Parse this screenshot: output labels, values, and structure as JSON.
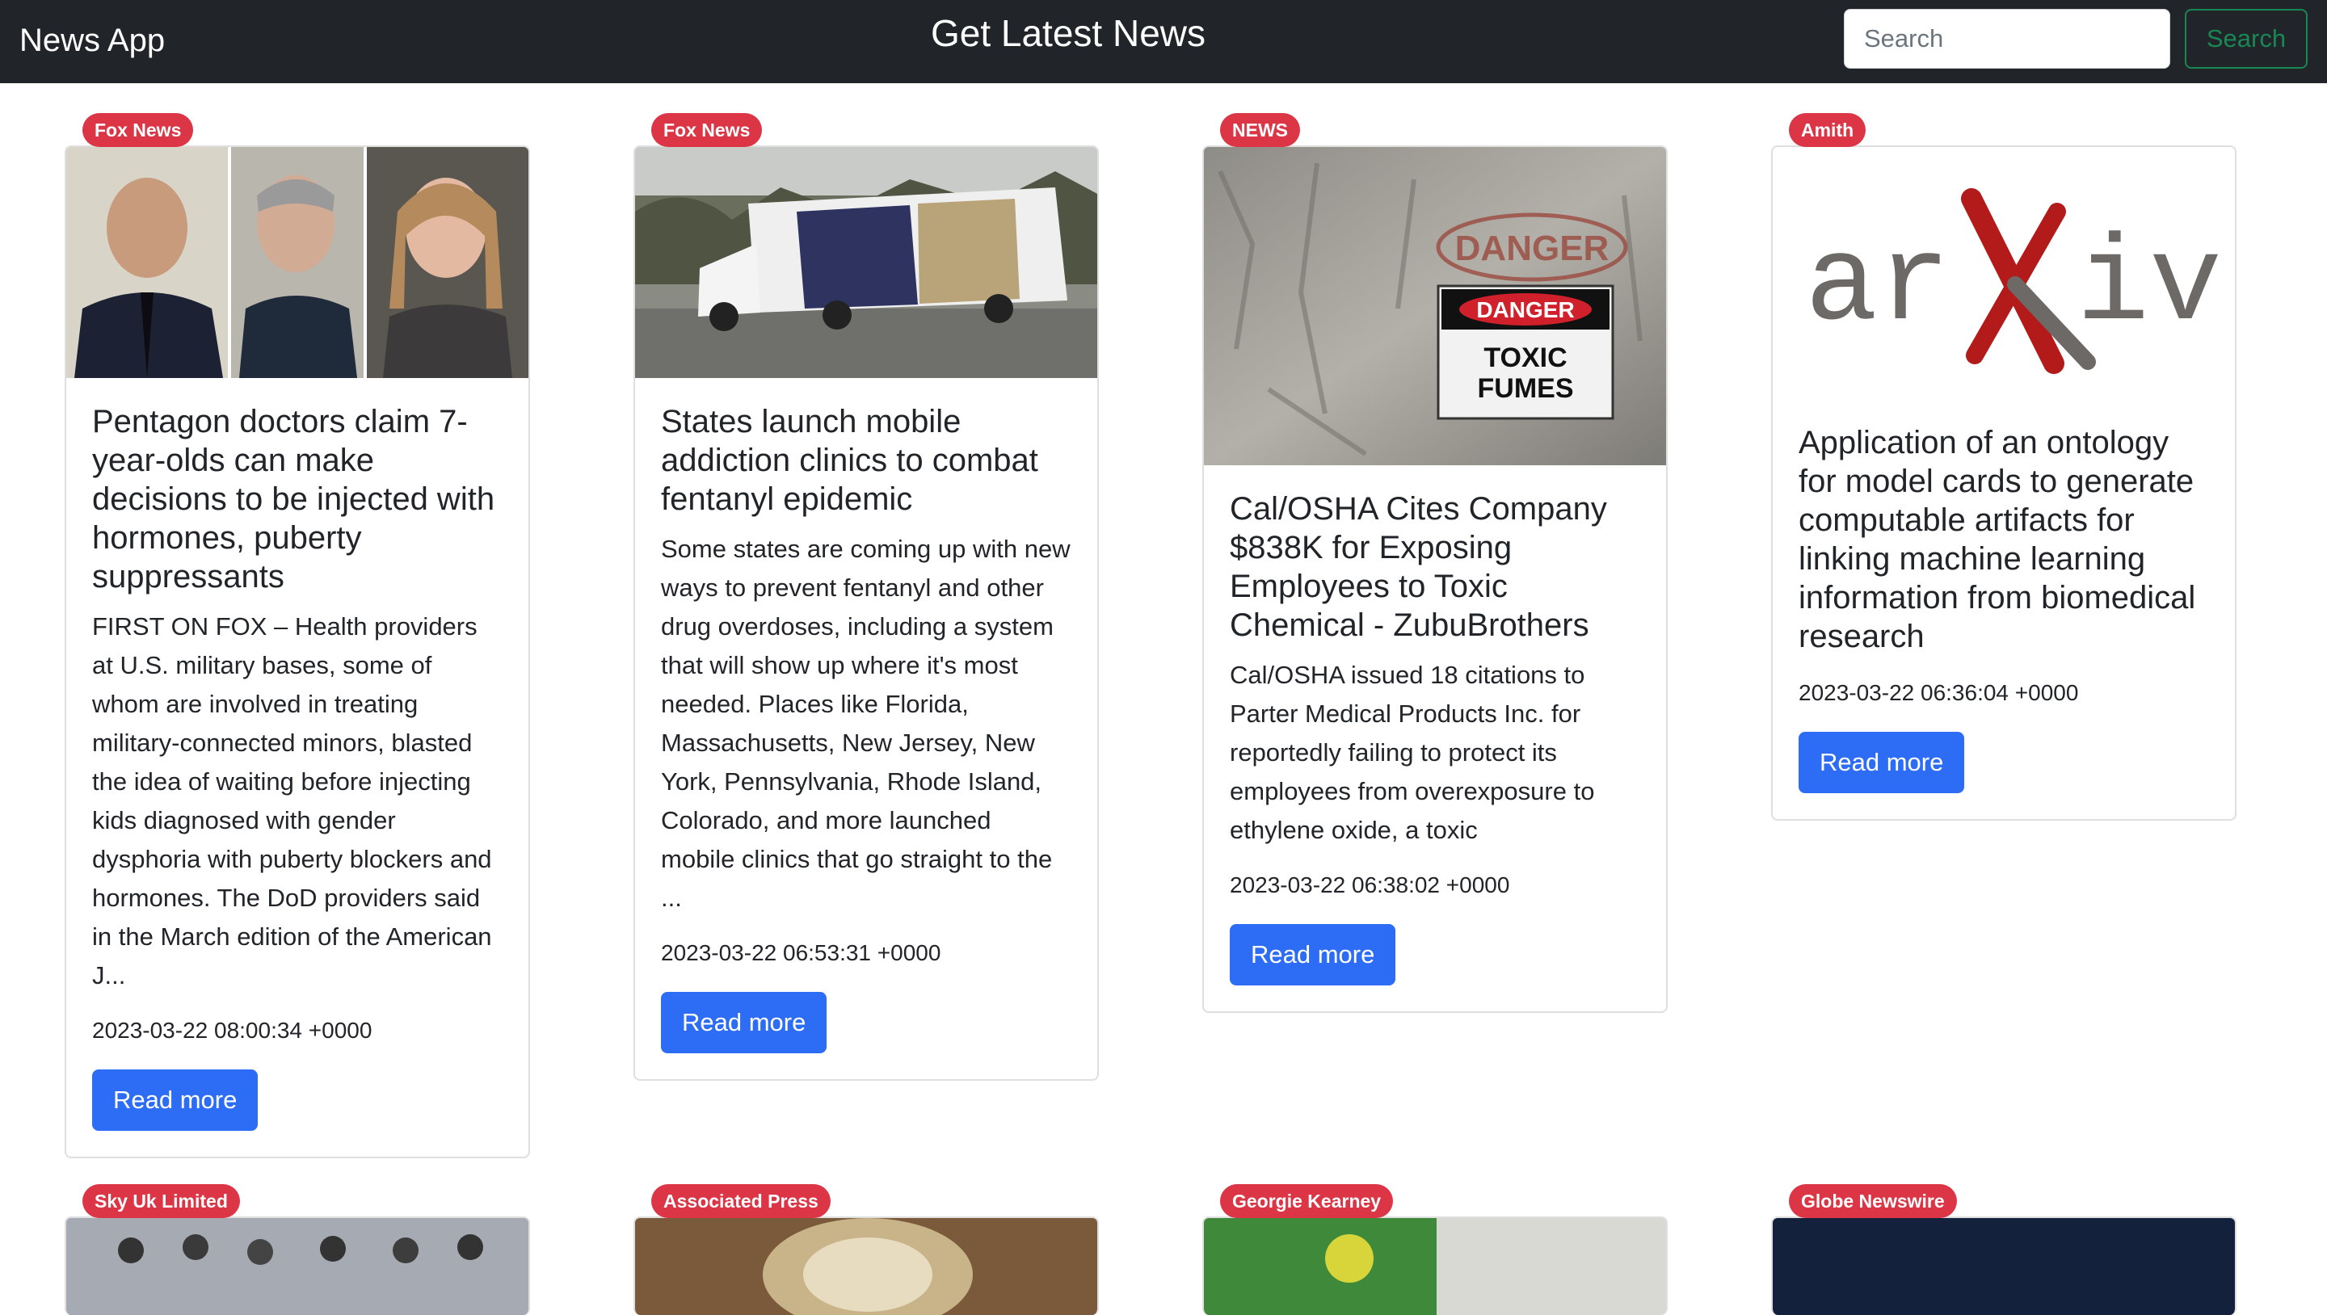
{
  "navbar": {
    "brand": "News App",
    "title": "Get Latest News",
    "search_placeholder": "Search",
    "search_button": "Search"
  },
  "articles": [
    {
      "source": "Fox News",
      "title": "Pentagon doctors claim 7-year-olds can make decisions to be injected with hormones, puberty suppressants",
      "description": "FIRST ON FOX – Health providers at U.S. military bases, some of whom are involved in treating military-connected minors, blasted the idea of waiting before injecting kids diagnosed with gender dysphoria with puberty blockers and hormones. The DoD providers said in the March edition of the American J...",
      "date": "2023-03-22 08:00:34 +0000",
      "button": "Read more"
    },
    {
      "source": "Fox News",
      "title": "States launch mobile addiction clinics to combat fentanyl epidemic",
      "description": "Some states are coming up with new ways to prevent fentanyl and other drug overdoses, including a system that will show up where it's most needed. Places like Florida, Massachusetts, New Jersey, New York, Pennsylvania, Rhode Island, Colorado, and more launched mobile clinics that go straight to the ...",
      "date": "2023-03-22 06:53:31 +0000",
      "button": "Read more"
    },
    {
      "source": "NEWS",
      "title": "Cal/OSHA Cites Company $838K for Exposing Employees to Toxic Chemical - ZubuBrothers",
      "description": "Cal/OSHA issued 18 citations to Parter Medical Products Inc. for reportedly failing to protect its employees from overexposure to ethylene oxide, a toxic",
      "date": "2023-03-22 06:38:02 +0000",
      "button": "Read more",
      "image_text": {
        "sign_top": "DANGER",
        "sign_line1": "TOXIC",
        "sign_line2": "FUMES",
        "wall_text": "DANGER"
      }
    },
    {
      "source": "Amith",
      "title": "Application of an ontology for model cards to generate computable artifacts for linking machine learning information from biomedical research",
      "description": "",
      "date": "2023-03-22 06:36:04 +0000",
      "button": "Read more",
      "image_text": {
        "logo_left": "ar",
        "logo_right": "iv"
      }
    }
  ],
  "second_row_sources": [
    "Sky Uk Limited",
    "Associated Press",
    "Georgie Kearney",
    "Globe Newswire"
  ],
  "colors": {
    "navbar": "#212529",
    "badge": "#dc3545",
    "primary_button": "#2d6df6",
    "search_outline": "#198754"
  }
}
